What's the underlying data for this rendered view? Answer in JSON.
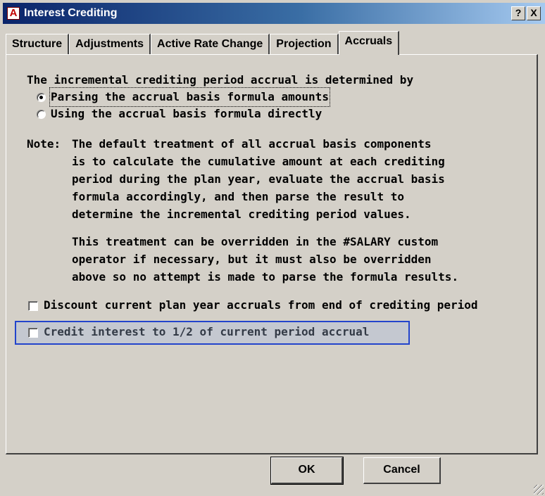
{
  "window": {
    "title": "Interest Crediting",
    "help_label": "?",
    "close_label": "X",
    "app_icon_glyph": "A"
  },
  "tabs": [
    {
      "label": "Structure",
      "active": false
    },
    {
      "label": "Adjustments",
      "active": false
    },
    {
      "label": "Active Rate Change",
      "active": false
    },
    {
      "label": "Projection",
      "active": false
    },
    {
      "label": "Accruals",
      "active": true
    }
  ],
  "accruals": {
    "intro": "The incremental crediting period accrual is determined by",
    "options": [
      {
        "label": "Parsing the accrual basis formula amounts",
        "selected": true
      },
      {
        "label": "Using the accrual basis formula directly",
        "selected": false
      }
    ],
    "note_label": "Note:",
    "note_lines": [
      "The default treatment of all accrual basis components",
      "is to calculate the cumulative amount at each crediting",
      "period during the plan year, evaluate the accrual basis",
      "formula accordingly, and then parse the result to",
      "determine the incremental crediting period values.",
      "This treatment can be overridden in the #SALARY custom",
      "operator if necessary, but it must also be overridden",
      "above so no attempt is made to parse the formula results."
    ],
    "checkboxes": [
      {
        "label": "Discount current plan year accruals from end of crediting period",
        "checked": false
      },
      {
        "label": "Credit interest to 1/2 of current period accrual",
        "checked": false
      }
    ]
  },
  "buttons": {
    "ok": "OK",
    "cancel": "Cancel"
  },
  "colors": {
    "titlebar_start": "#0a246a",
    "titlebar_end": "#a6caf0",
    "dialog_face": "#d4d0c8",
    "highlight_border": "#2244cc"
  }
}
